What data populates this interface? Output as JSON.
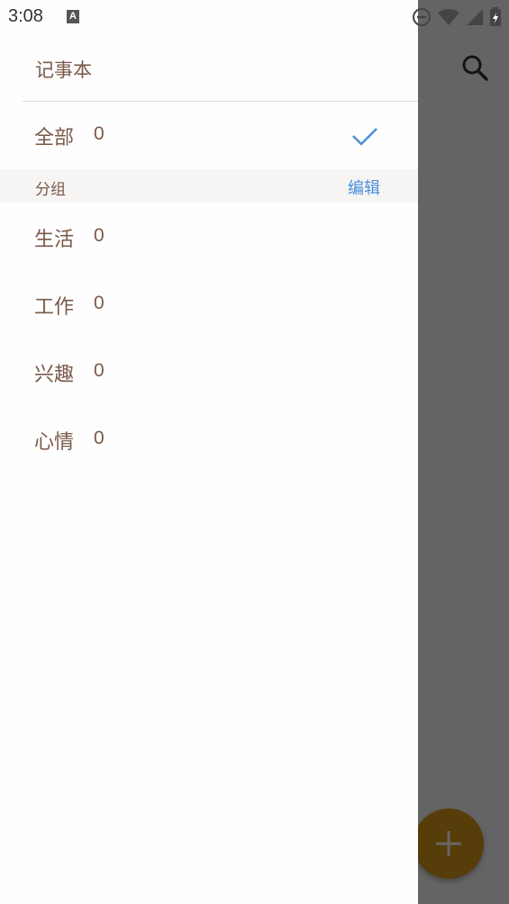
{
  "status_bar": {
    "time": "3:08",
    "icons": [
      "a-notification-icon",
      "do-not-disturb-icon",
      "wifi-icon",
      "signal-icon",
      "battery-icon"
    ]
  },
  "app": {
    "search_icon": "search-icon",
    "fab_icon": "plus-icon",
    "fab_color": "#d89a17"
  },
  "drawer": {
    "title": "记事本",
    "all": {
      "label": "全部",
      "count": "0",
      "selected": true
    },
    "section": {
      "label": "分组",
      "edit_label": "编辑"
    },
    "groups": [
      {
        "label": "生活",
        "count": "0"
      },
      {
        "label": "工作",
        "count": "0"
      },
      {
        "label": "兴趣",
        "count": "0"
      },
      {
        "label": "心情",
        "count": "0"
      }
    ]
  },
  "colors": {
    "text": "#7a5a4a",
    "accent": "#4a90d9"
  }
}
